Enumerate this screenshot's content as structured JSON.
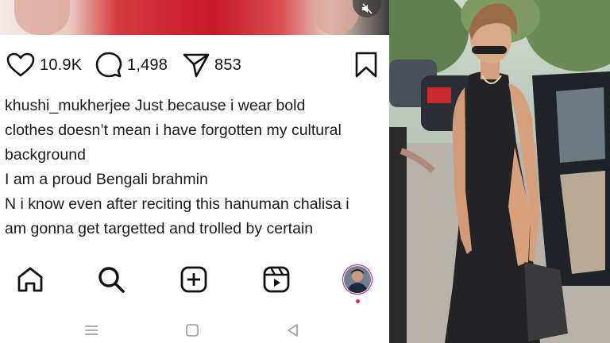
{
  "post": {
    "likes": "10.9K",
    "comments": "1,498",
    "shares": "853"
  },
  "caption": {
    "username": "khushi_mukherjee",
    "lines": [
      "Just because i wear bold",
      "clothes doesn’t mean i have forgotten my cultural",
      "background",
      "I am a proud Bengali brahmin",
      "N i know even after reciting this hanuman chalisa i",
      "am gonna get targetted and trolled by certain"
    ]
  },
  "icons": {
    "like": "heart-icon",
    "comment": "comment-bubble-icon",
    "share": "paper-plane-icon",
    "save": "bookmark-icon",
    "mute": "speaker-muted-icon",
    "home": "home-icon",
    "search": "search-icon",
    "create": "plus-square-icon",
    "reels": "reels-icon",
    "profile": "profile-avatar",
    "sys_menu": "menu-lines-icon",
    "sys_home": "square-icon",
    "sys_back": "back-triangle-icon"
  },
  "colors": {
    "text": "#111111",
    "notification_dot": "#e0245e",
    "media_accent": "#c8182a"
  }
}
